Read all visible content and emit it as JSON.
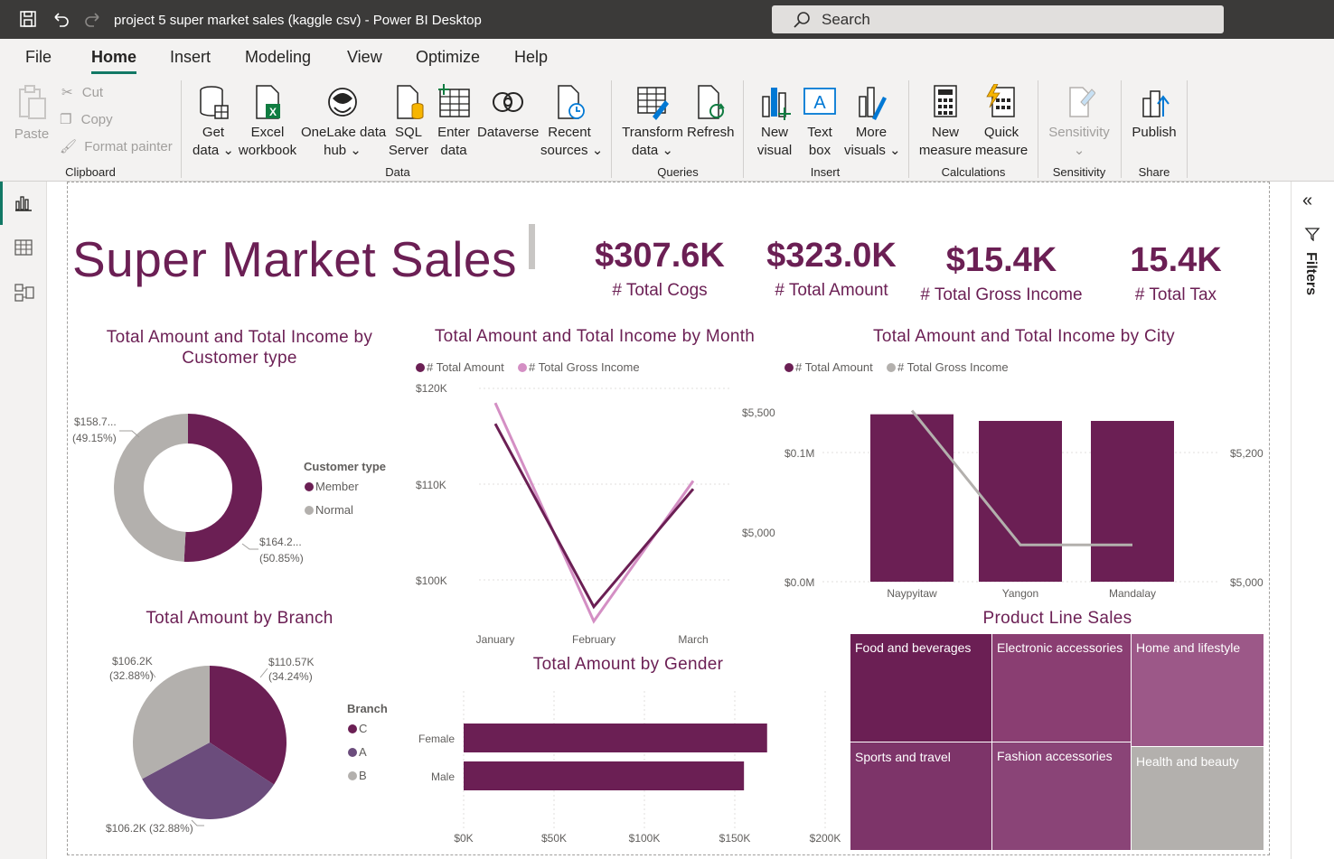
{
  "titlebar": {
    "title": "project 5 super market sales (kaggle csv) - Power BI Desktop",
    "search_placeholder": "Search"
  },
  "tabs": [
    "File",
    "Home",
    "Insert",
    "Modeling",
    "View",
    "Optimize",
    "Help"
  ],
  "ribbon": {
    "paste": "Paste",
    "cut": "Cut",
    "copy": "Copy",
    "format_painter": "Format painter",
    "clipboard": "Clipboard",
    "get_data_1": "Get",
    "get_data_2": "data",
    "excel_1": "Excel",
    "excel_2": "workbook",
    "onelake_1": "OneLake data",
    "onelake_2": "hub",
    "sql_1": "SQL",
    "sql_2": "Server",
    "enter_1": "Enter",
    "enter_2": "data",
    "dataverse": "Dataverse",
    "recent_1": "Recent",
    "recent_2": "sources",
    "data_group": "Data",
    "transform_1": "Transform",
    "transform_2": "data",
    "refresh": "Refresh",
    "queries_group": "Queries",
    "newvisual_1": "New",
    "newvisual_2": "visual",
    "textbox_1": "Text",
    "textbox_2": "box",
    "more_1": "More",
    "more_2": "visuals",
    "insert_group": "Insert",
    "newmeasure_1": "New",
    "newmeasure_2": "measure",
    "quick_1": "Quick",
    "quick_2": "measure",
    "calc_group": "Calculations",
    "sensitivity": "Sensitivity",
    "sensitivity_group": "Sensitivity",
    "publish": "Publish",
    "share_group": "Share"
  },
  "filters_label": "Filters",
  "report": {
    "title": "Super Market Sales",
    "kpis": [
      {
        "value": "$307.6K",
        "label": "# Total Cogs"
      },
      {
        "value": "$323.0K",
        "label": "# Total Amount"
      },
      {
        "value": "$15.4K",
        "label": "# Total Gross Income"
      },
      {
        "value": "15.4K",
        "label": "# Total Tax"
      }
    ],
    "donut_title": "Total Amount and Total Income by Customer type",
    "donut_legend_title": "Customer type",
    "donut_legend": [
      "Member",
      "Normal"
    ],
    "donut_label_normal_1": "$158.7...",
    "donut_label_normal_2": "(49.15%)",
    "donut_label_member_1": "$164.2...",
    "donut_label_member_2": "(50.85%)",
    "line_title": "Total Amount and Total Income by Month",
    "legend_amount": "# Total Amount",
    "legend_income": "# Total Gross Income",
    "line_y_left": [
      "$120K",
      "$110K",
      "$100K"
    ],
    "line_y_right": [
      "$5,500",
      "$5,000"
    ],
    "city_title": "Total Amount and Total Income by City",
    "city_y_left": [
      "$0.1M",
      "$0.0M"
    ],
    "city_y_right": [
      "$5,200",
      "$5,000"
    ],
    "branch_title": "Total Amount by Branch",
    "branch_legend_title": "Branch",
    "branch_legend": [
      "C",
      "A",
      "B"
    ],
    "branch_label_c_1": "$110.57K",
    "branch_label_c_2": "(34.24%)",
    "branch_label_b_1": "$106.2K",
    "branch_label_b_2": "(32.88%)",
    "branch_label_a": "$106.2K (32.88%)",
    "gender_title": "Total Amount by Gender",
    "product_title": "Product Line Sales",
    "product_lines": [
      "Food and beverages",
      "Electronic accessories",
      "Home and lifestyle",
      "Sports and travel",
      "Fashion accessories",
      "Health and beauty"
    ]
  },
  "colors": {
    "member": "#6b1f54",
    "normal": "#b3b0ad",
    "income_line": "#d48fc4",
    "branch_a": "#6b4c7c",
    "accent": "#117865"
  },
  "chart_data": [
    {
      "type": "pie",
      "title": "Total Amount and Total Income by Customer type",
      "categories": [
        "Member",
        "Normal"
      ],
      "values": [
        164.2,
        158.7
      ],
      "percent": [
        50.85,
        49.15
      ],
      "unit": "$K"
    },
    {
      "type": "line",
      "title": "Total Amount and Total Income by Month",
      "categories": [
        "January",
        "February",
        "March"
      ],
      "series": [
        {
          "name": "# Total Amount",
          "values": [
            116.3,
            97.2,
            109.5
          ],
          "axis": "left"
        },
        {
          "name": "# Total Gross Income",
          "values": [
            5537,
            4629,
            5213
          ],
          "axis": "right"
        }
      ],
      "ylim_left": [
        96000,
        124000
      ],
      "yticks_left": [
        "$100K",
        "$110K",
        "$120K"
      ],
      "ylim_right": [
        4560,
        5700
      ],
      "yticks_right": [
        "$5,000",
        "$5,500"
      ]
    },
    {
      "type": "bar",
      "title": "Total Amount and Total Income by City",
      "categories": [
        "Naypyitaw",
        "Yangon",
        "Mandalay"
      ],
      "series": [
        {
          "name": "# Total Amount",
          "values": [
            110568,
            106200,
            106198
          ],
          "axis": "left"
        },
        {
          "name": "# Total Gross Income",
          "values": [
            5265,
            5057,
            5057
          ],
          "axis": "right"
        }
      ],
      "ylim_left": [
        0,
        120000
      ],
      "yticks_left": [
        "$0.0M",
        "$0.1M"
      ],
      "ylim_right": [
        5000,
        5200
      ],
      "yticks_right": [
        "$5,000",
        "$5,200"
      ]
    },
    {
      "type": "pie",
      "title": "Total Amount by Branch",
      "categories": [
        "C",
        "A",
        "B"
      ],
      "values": [
        110.57,
        106.2,
        106.2
      ],
      "percent": [
        34.24,
        32.88,
        32.88
      ],
      "unit": "$K"
    },
    {
      "type": "bar",
      "title": "Total Amount by Gender",
      "orientation": "horizontal",
      "categories": [
        "Female",
        "Male"
      ],
      "values": [
        167883,
        155084
      ],
      "xlim": [
        0,
        200000
      ],
      "xticks": [
        "$0K",
        "$50K",
        "$100K",
        "$150K",
        "$200K"
      ]
    },
    {
      "type": "heatmap",
      "title": "Product Line Sales",
      "subtype": "treemap",
      "categories": [
        "Food and beverages",
        "Electronic accessories",
        "Home and lifestyle",
        "Sports and travel",
        "Fashion accessories",
        "Health and beauty"
      ]
    }
  ]
}
